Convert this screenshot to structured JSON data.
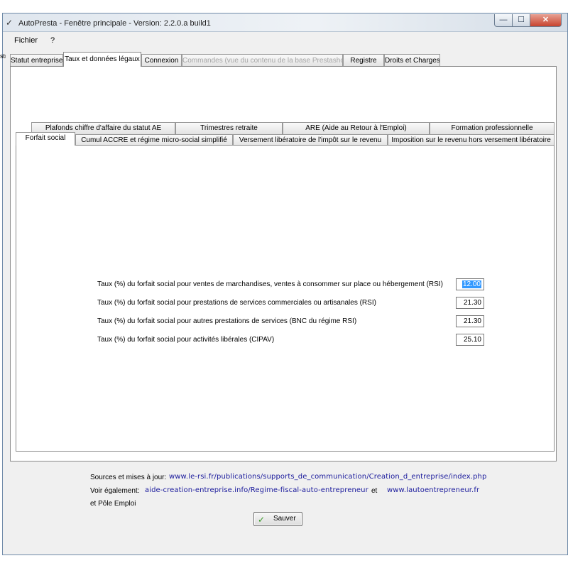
{
  "window": {
    "title": "AutoPresta - Fenêtre principale  -  Version: 2.2.0.a build1",
    "app_icon": "✓",
    "controls": {
      "minimize": "—",
      "maximize": "☐",
      "close": "✕"
    }
  },
  "menu": {
    "items": [
      "Fichier",
      "?"
    ]
  },
  "left_stub": "str",
  "main_tabs": [
    {
      "label": "Statut entreprise",
      "state": "normal"
    },
    {
      "label": "Taux et données légaux",
      "state": "active"
    },
    {
      "label": "Connexion",
      "state": "normal"
    },
    {
      "label": "Commandes (vue du contenu de la base Prestashop)",
      "state": "disabled"
    },
    {
      "label": "Registre",
      "state": "normal"
    },
    {
      "label": "Droits et Charges",
      "state": "normal"
    }
  ],
  "sub_tabs_row1": [
    {
      "label": "Plafonds chiffre d'affaire du statut AE"
    },
    {
      "label": "Trimestres retraite"
    },
    {
      "label": "ARE (Aide au Retour à l'Emploi)"
    },
    {
      "label": "Formation professionnelle"
    }
  ],
  "sub_tabs_row2": [
    {
      "label": "Forfait social",
      "state": "active"
    },
    {
      "label": "Cumul ACCRE et régime micro-social simplifié"
    },
    {
      "label": "Versement libératoire de l'impôt sur le revenu"
    },
    {
      "label": "Imposition sur le revenu hors versement libératoire"
    }
  ],
  "fields": [
    {
      "label": "Taux (%) du forfait social pour ventes de marchandises, ventes à consommer sur place ou hébergement  (RSI)",
      "value": "12.00"
    },
    {
      "label": "Taux (%) du forfait social pour prestations de services commerciales ou artisanales (RSI)",
      "value": "21.30"
    },
    {
      "label": "Taux (%) du forfait social pour autres prestations de services (BNC du régime RSI)",
      "value": "21.30"
    },
    {
      "label": "Taux (%) du forfait social pour activités libérales (CIPAV)",
      "value": "25.10"
    }
  ],
  "sources": {
    "label": "Sources et mises à jour:",
    "link1": "www.le-rsi.fr/publications/supports_de_communication/Creation_d_entreprise/index.php",
    "see_also_label": "Voir également:",
    "link2": "aide-creation-entreprise.info/Regime-fiscal-auto-entrepreneur",
    "and_label": "et",
    "link3": "www.lautoentrepreneur.fr",
    "pole_emploi": "et Pôle Emploi"
  },
  "save": {
    "label": "Sauver",
    "icon": "✓"
  }
}
